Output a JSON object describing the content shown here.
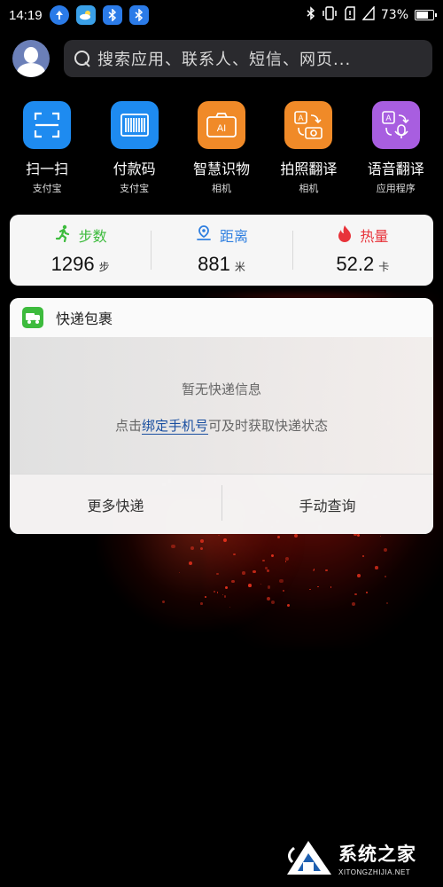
{
  "status_bar": {
    "time": "14:19",
    "battery_percent": "73%",
    "battery_level": 0.73
  },
  "search": {
    "placeholder": "搜索应用、联系人、短信、网页..."
  },
  "apps": [
    {
      "label": "扫一扫",
      "sub": "支付宝",
      "icon": "scan-icon",
      "color": "#1e8bf0"
    },
    {
      "label": "付款码",
      "sub": "支付宝",
      "icon": "barcode-icon",
      "color": "#1e8bf0"
    },
    {
      "label": "智慧识物",
      "sub": "相机",
      "icon": "ai-camera-icon",
      "color": "#f08a28"
    },
    {
      "label": "拍照翻译",
      "sub": "相机",
      "icon": "photo-translate-icon",
      "color": "#f08a28"
    },
    {
      "label": "语音翻译",
      "sub": "应用程序",
      "icon": "voice-translate-icon",
      "color": "#a85ee0"
    }
  ],
  "stats": [
    {
      "label": "步数",
      "value": "1296",
      "unit": "步",
      "icon": "running-icon",
      "color": "#3dbb3d"
    },
    {
      "label": "距离",
      "value": "881",
      "unit": "米",
      "icon": "location-icon",
      "color": "#2f7fe0"
    },
    {
      "label": "热量",
      "value": "52.2",
      "unit": "卡",
      "icon": "flame-icon",
      "color": "#e8333a"
    }
  ],
  "express": {
    "title": "快递包裹",
    "empty_message": "暂无快递信息",
    "bind_prefix": "点击",
    "bind_link": "绑定手机号",
    "bind_suffix": "可及时获取快递状态",
    "actions": [
      "更多快递",
      "手动查询"
    ]
  },
  "watermark": {
    "cn": "系统之家",
    "en": "XITONGZHIJIA.NET"
  }
}
